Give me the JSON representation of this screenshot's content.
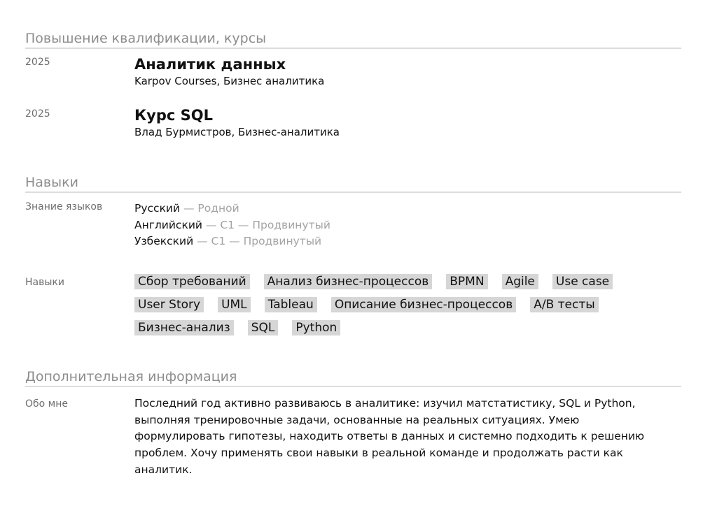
{
  "courses_section": {
    "title": "Повышение квалификации, курсы",
    "items": [
      {
        "year": "2025",
        "title": "Аналитик данных",
        "org": "Karpov Courses, Бизнес аналитика"
      },
      {
        "year": "2025",
        "title": "Курс SQL",
        "org": "Влад Бурмистров, Бизнес-аналитика"
      }
    ]
  },
  "skills_section": {
    "title": "Навыки",
    "languages_label": "Знание языков",
    "languages": [
      {
        "name": "Русский",
        "level": " — Родной"
      },
      {
        "name": "Английский",
        "level": " — C1 — Продвинутый"
      },
      {
        "name": "Узбекский",
        "level": " — C1 — Продвинутый"
      }
    ],
    "skills_label": "Навыки",
    "tags": [
      "Сбор требований",
      "Анализ бизнес-процессов",
      "BPMN",
      "Agile",
      "Use case",
      "User Story",
      "UML",
      "Tableau",
      "Описание бизнес-процессов",
      "A/B тесты",
      "Бизнес-анализ",
      "SQL",
      "Python"
    ]
  },
  "additional_section": {
    "title": "Дополнительная информация",
    "about_label": "Обо мне",
    "about_text": "Последний год активно развиваюсь в аналитике: изучил матстатистику, SQL и Python, выполняя тренировочные задачи, основанные на реальных ситуациях. Умею формулировать гипотезы, находить ответы в данных и системно подходить к решению проблем. Хочу применять свои навыки в реальной команде и продолжать расти как аналитик."
  }
}
